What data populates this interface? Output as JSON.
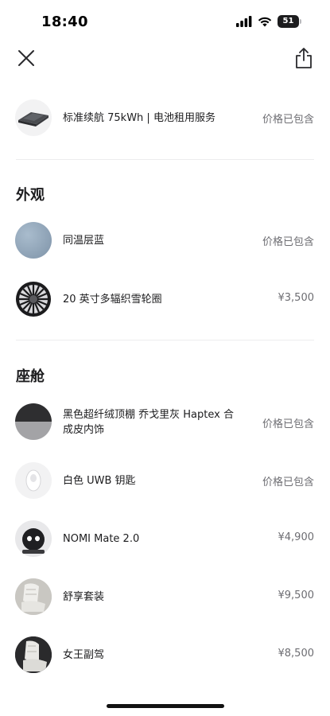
{
  "status_bar": {
    "time": "18:40",
    "battery": "51"
  },
  "header": {
    "close_icon": "close-icon",
    "share_icon": "share-icon"
  },
  "battery_item": {
    "label": "标准续航 75kWh | 电池租用服务",
    "price": "价格已包含"
  },
  "exterior": {
    "title": "外观",
    "items": [
      {
        "label": "同温层蓝",
        "price": "价格已包含",
        "swatch": "#8fa3b7"
      },
      {
        "label": "20 英寸多辐织雪轮圈",
        "price": "¥3,500"
      }
    ]
  },
  "cabin": {
    "title": "座舱",
    "items": [
      {
        "label": "黑色超纤绒顶棚 乔戈里灰 Haptex 合成皮内饰",
        "price": "价格已包含"
      },
      {
        "label": "白色 UWB 钥匙",
        "price": "价格已包含"
      },
      {
        "label": "NOMI Mate 2.0",
        "price": "¥4,900"
      },
      {
        "label": "舒享套装",
        "price": "¥9,500"
      },
      {
        "label": "女王副驾",
        "price": "¥8,500"
      }
    ]
  },
  "colors": {
    "text": "#1c1c1e",
    "secondary": "#6d6d72",
    "divider": "#ececee"
  }
}
